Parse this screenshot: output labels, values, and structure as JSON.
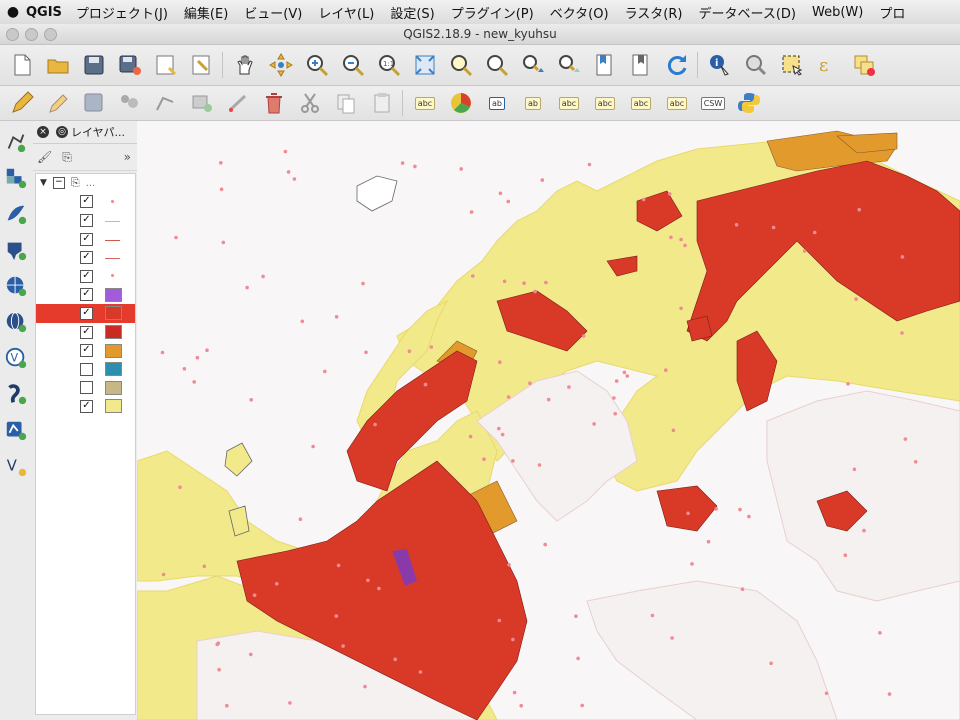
{
  "menubar": {
    "apple": "",
    "app": "QGIS",
    "items": [
      "プロジェクト(J)",
      "編集(E)",
      "ビュー(V)",
      "レイヤ(L)",
      "設定(S)",
      "プラグイン(P)",
      "ベクタ(O)",
      "ラスタ(R)",
      "データベース(D)",
      "Web(W)",
      "プロ"
    ]
  },
  "window": {
    "title": "QGIS2.18.9 - new_kyuhsu"
  },
  "toolbar1": [
    "new-project-icon",
    "open-project-icon",
    "save-project-icon",
    "save-as-icon",
    "new-print-composer-icon",
    "composer-manager-icon",
    "pan-hand-icon",
    "pan-to-selection-icon",
    "zoom-in-icon",
    "zoom-out-icon",
    "zoom-actual-icon",
    "zoom-full-icon",
    "zoom-to-selection-icon",
    "zoom-to-layer-icon",
    "zoom-last-icon",
    "zoom-next-icon",
    "new-bookmark-icon",
    "show-bookmarks-icon",
    "refresh-icon",
    "identify-icon",
    "select-icon",
    "select-feature-icon",
    "expression-icon",
    "deselect-icon"
  ],
  "toolbar2": {
    "icons": [
      "pencil-edit-icon",
      "toggle-editing-icon",
      "save-edits-icon",
      "digitize-icon",
      "add-feature-icon",
      "move-feature-icon",
      "node-tool-icon",
      "delete-selected-icon",
      "cut-features-icon",
      "copy-features-icon",
      "paste-features-icon",
      "label-icon",
      "diagram-icon",
      "label-pin-icon",
      "label-show-hide-icon",
      "label-move-icon",
      "label-rotate-icon",
      "label-change-icon",
      "csw-icon",
      "python-console-icon"
    ],
    "label_abc": "abc",
    "label_ab": "ab",
    "label_csw": "CSW"
  },
  "leftbar": [
    "add-vector-icon",
    "add-raster-icon",
    "add-spatialite-icon",
    "add-wms-icon",
    "add-wfs-icon",
    "add-wcs-icon",
    "add-virtual-layer-icon",
    "add-gps-icon",
    "new-shapefile-icon",
    "new-vertex-icon"
  ],
  "layers_panel": {
    "title": "レイヤパ...",
    "collapse": "»",
    "root_dots": "...",
    "layers": [
      {
        "checked": true,
        "symbol": "dot",
        "color": "#f08888"
      },
      {
        "checked": true,
        "symbol": "line",
        "color": "#e4a9a2"
      },
      {
        "checked": true,
        "symbol": "line",
        "color": "#d05a4a"
      },
      {
        "checked": true,
        "symbol": "line",
        "color": "#d46a5a"
      },
      {
        "checked": true,
        "symbol": "dot",
        "color": "#f08888"
      },
      {
        "checked": true,
        "symbol": "fill",
        "color": "#a35bd9"
      },
      {
        "checked": true,
        "symbol": "fill",
        "color": "#d93a28",
        "selected": true
      },
      {
        "checked": true,
        "symbol": "fill",
        "color": "#c92a22"
      },
      {
        "checked": true,
        "symbol": "fill",
        "color": "#e29a2c"
      },
      {
        "checked": false,
        "symbol": "fill",
        "color": "#2d8fb0"
      },
      {
        "checked": false,
        "symbol": "fill",
        "color": "#c6b884"
      },
      {
        "checked": true,
        "symbol": "fill",
        "color": "#f2e98b"
      }
    ]
  },
  "map": {
    "background": "#f8f6f6",
    "colors": {
      "land": "#f2e98b",
      "urban_dense": "#d93a28",
      "urban_dark": "#b8241f",
      "urban_mid": "#e29a2c",
      "purple": "#8a3aa8",
      "point": "#f08a94",
      "unfilled": "#f6f1f1"
    }
  }
}
